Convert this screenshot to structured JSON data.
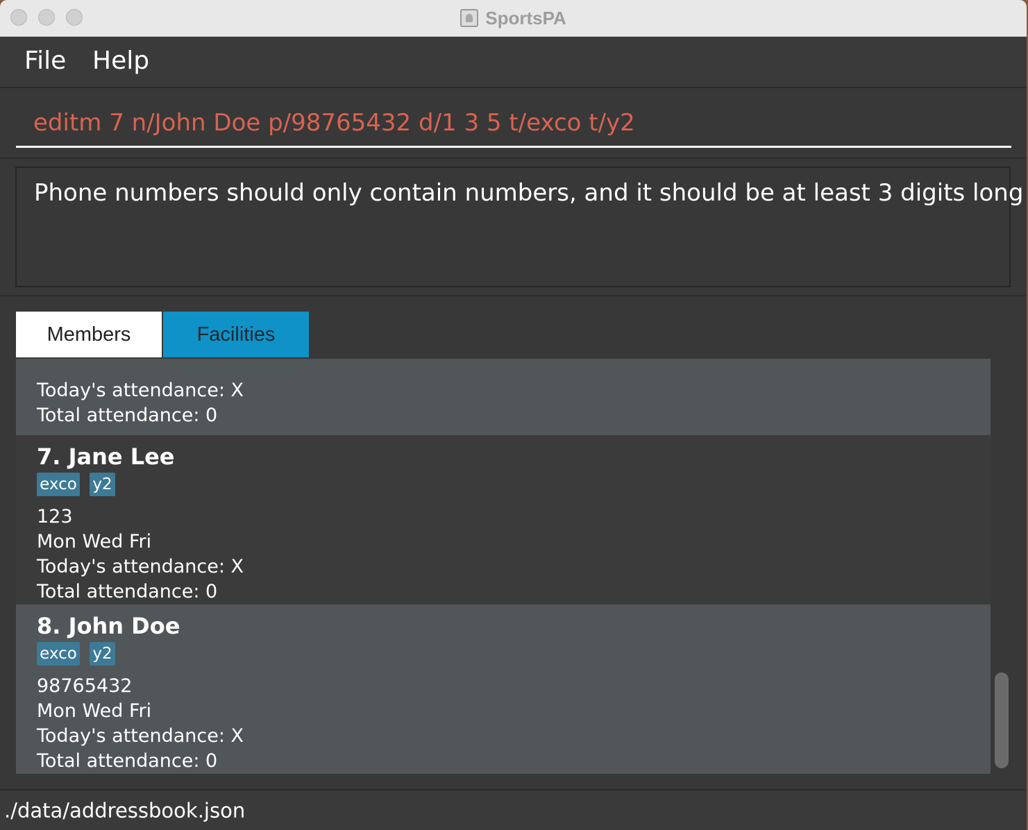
{
  "window": {
    "title": "SportsPA"
  },
  "menu": {
    "file": "File",
    "help": "Help"
  },
  "command": {
    "value": "editm 7 n/John Doe p/98765432 d/1 3 5 t/exco t/y2"
  },
  "result": {
    "text": "Phone numbers should only contain numbers, and it should be at least 3 digits long"
  },
  "tabs": [
    {
      "label": "Members",
      "selected": true
    },
    {
      "label": "Facilities",
      "selected": false
    }
  ],
  "members_partial": {
    "todays_attendance": "Today's attendance: X",
    "total_attendance": "Total attendance: 0"
  },
  "members": [
    {
      "name": "7.  Jane Lee",
      "tags": [
        "exco",
        "y2"
      ],
      "phone": "123",
      "days": "Mon Wed Fri",
      "todays_attendance": "Today's attendance: X",
      "total_attendance": "Total attendance: 0"
    },
    {
      "name": "8.  John Doe",
      "tags": [
        "exco",
        "y2"
      ],
      "phone": "98765432",
      "days": "Mon Wed Fri",
      "todays_attendance": "Today's attendance: X",
      "total_attendance": "Total attendance: 0"
    }
  ],
  "status": {
    "path": "./data/addressbook.json"
  },
  "colors": {
    "command_text": "#d9634f",
    "tag_bg": "#3d7a96",
    "tab_active_bg": "#ffffff",
    "tab_inactive_bg": "#0f92c7"
  }
}
